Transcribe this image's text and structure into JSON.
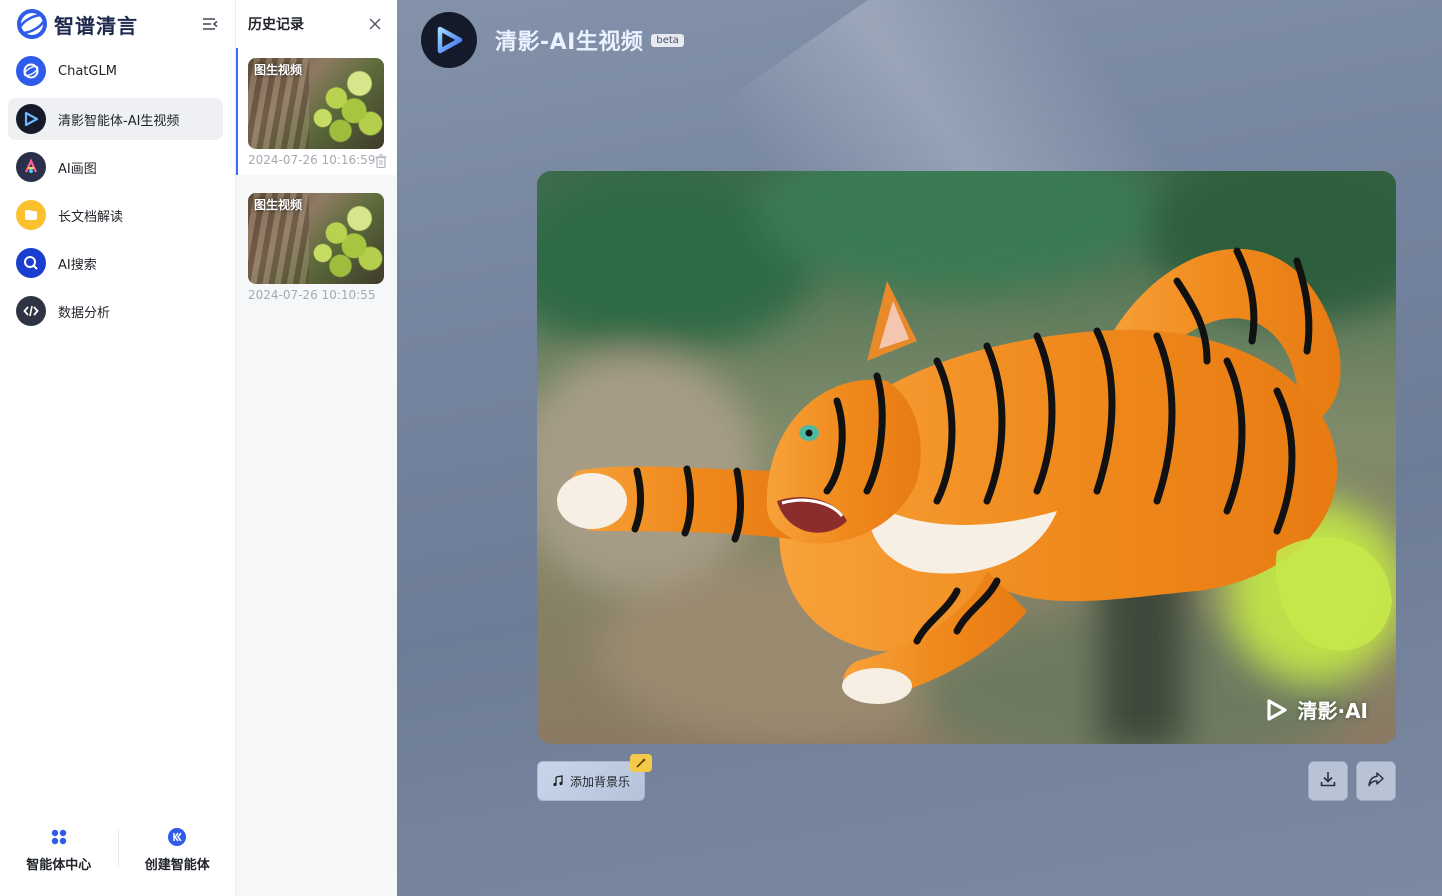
{
  "brand": {
    "name": "智谱清言"
  },
  "sidebar": {
    "items": [
      {
        "label": "ChatGLM",
        "icon": "chatglm-icon"
      },
      {
        "label": "清影智能体-AI生视频",
        "icon": "qingying-icon",
        "active": true
      },
      {
        "label": "AI画图",
        "icon": "ai-draw-icon"
      },
      {
        "label": "长文档解读",
        "icon": "document-icon"
      },
      {
        "label": "AI搜索",
        "icon": "ai-search-icon"
      },
      {
        "label": "数据分析",
        "icon": "code-icon"
      }
    ],
    "footer": {
      "agent_center": "智能体中心",
      "create_agent": "创建智能体"
    }
  },
  "history": {
    "title": "历史记录",
    "items": [
      {
        "tag": "图生视频",
        "time": "2024-07-26 10:16:59",
        "active": true
      },
      {
        "tag": "图生视频",
        "time": "2024-07-26 10:10:55",
        "active": false
      }
    ]
  },
  "main": {
    "title": "清影-AI生视频",
    "badge": "beta",
    "watermark": "清影·AI",
    "music_button": "添加背景乐"
  },
  "colors": {
    "accent": "#3a6ff7",
    "active_bg": "#eef0f4",
    "main_bg": "#76859f"
  }
}
